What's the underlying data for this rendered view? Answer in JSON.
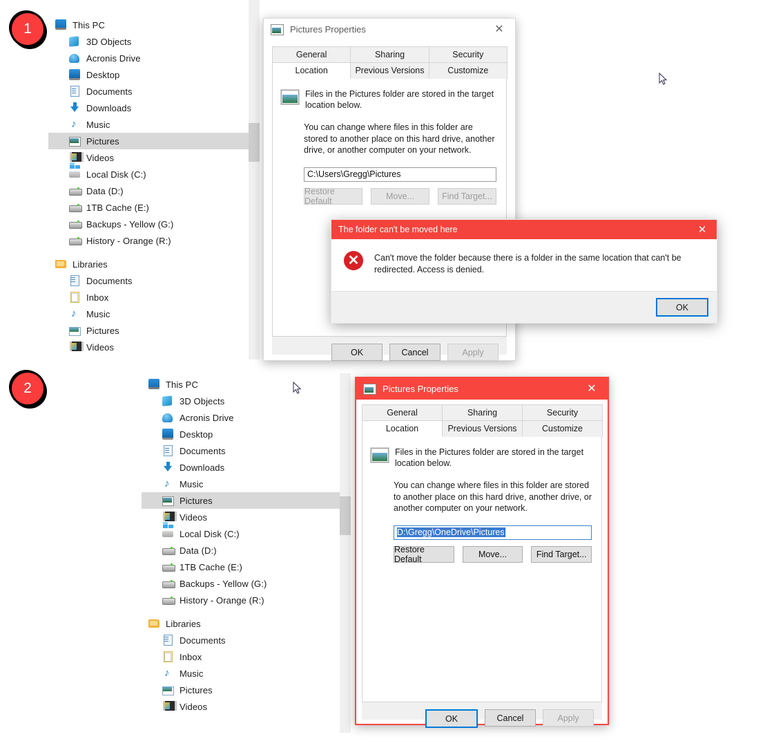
{
  "badges": {
    "one": "1",
    "two": "2"
  },
  "tree_items": [
    {
      "label": "This PC",
      "icon": "monitor-icon",
      "indent": 0,
      "selected": false
    },
    {
      "label": "3D Objects",
      "icon": "3d-objects-icon",
      "indent": 1,
      "selected": false
    },
    {
      "label": "Acronis Drive",
      "icon": "acronis-drive-icon",
      "indent": 1,
      "selected": false
    },
    {
      "label": "Desktop",
      "icon": "desktop-icon",
      "indent": 1,
      "selected": false
    },
    {
      "label": "Documents",
      "icon": "documents-icon",
      "indent": 1,
      "selected": false
    },
    {
      "label": "Downloads",
      "icon": "downloads-icon",
      "indent": 1,
      "selected": false
    },
    {
      "label": "Music",
      "icon": "music-icon",
      "indent": 1,
      "selected": false
    },
    {
      "label": "Pictures",
      "icon": "pictures-icon",
      "indent": 1,
      "selected": true
    },
    {
      "label": "Videos",
      "icon": "videos-icon",
      "indent": 1,
      "selected": false
    },
    {
      "label": "Local Disk (C:)",
      "icon": "local-disk-icon",
      "indent": 1,
      "selected": false
    },
    {
      "label": "Data (D:)",
      "icon": "drive-icon",
      "indent": 1,
      "selected": false
    },
    {
      "label": "1TB Cache (E:)",
      "icon": "drive-icon",
      "indent": 1,
      "selected": false
    },
    {
      "label": "Backups - Yellow (G:)",
      "icon": "drive-icon",
      "indent": 1,
      "selected": false
    },
    {
      "label": "History - Orange (R:)",
      "icon": "drive-icon",
      "indent": 1,
      "selected": false
    },
    {
      "label": "",
      "icon": "spacer",
      "indent": 0,
      "selected": false
    },
    {
      "label": "Libraries",
      "icon": "libraries-icon",
      "indent": 0,
      "selected": false
    },
    {
      "label": "Documents",
      "icon": "library-documents-icon",
      "indent": 1,
      "selected": false
    },
    {
      "label": "Inbox",
      "icon": "inbox-icon",
      "indent": 1,
      "selected": false
    },
    {
      "label": "Music",
      "icon": "music-icon",
      "indent": 1,
      "selected": false
    },
    {
      "label": "Pictures",
      "icon": "library-pictures-icon",
      "indent": 1,
      "selected": false
    },
    {
      "label": "Videos",
      "icon": "videos-icon",
      "indent": 1,
      "selected": false
    }
  ],
  "dialog": {
    "title": "Pictures Properties",
    "close_label": "✕",
    "tabs_row1": [
      "General",
      "Sharing",
      "Security"
    ],
    "tabs_row2": [
      "Location",
      "Previous Versions",
      "Customize"
    ],
    "active_tab": "Location",
    "header_text": "Files in the Pictures folder are stored in the target location below.",
    "body_text": "You can change where files in this folder are stored to another place on this hard drive, another drive, or another computer on your network.",
    "action_buttons": [
      "Restore Default",
      "Move...",
      "Find Target..."
    ],
    "footer_buttons": [
      "OK",
      "Cancel",
      "Apply"
    ]
  },
  "panel1": {
    "path_value": "C:\\Users\\Gregg\\Pictures",
    "actions_disabled": true,
    "footer_apply_disabled": true,
    "titlebar_color": "#ffffff",
    "title_color": "#5a5a5a"
  },
  "panel2": {
    "path_value": "D:\\Gregg\\OneDrive\\Pictures",
    "actions_disabled": false,
    "footer_apply_disabled": true,
    "titlebar_color": "#f8463f",
    "title_color": "#ffffff",
    "path_selected": true,
    "ok_focused": true
  },
  "error_dialog": {
    "title": "The folder can't be moved here",
    "close_label": "✕",
    "icon": "error-x-icon",
    "message": "Can't move the folder because there is a folder in the same location that can't be redirected. Access is denied.",
    "ok_label": "OK",
    "titlebar_color": "#f4433c"
  }
}
